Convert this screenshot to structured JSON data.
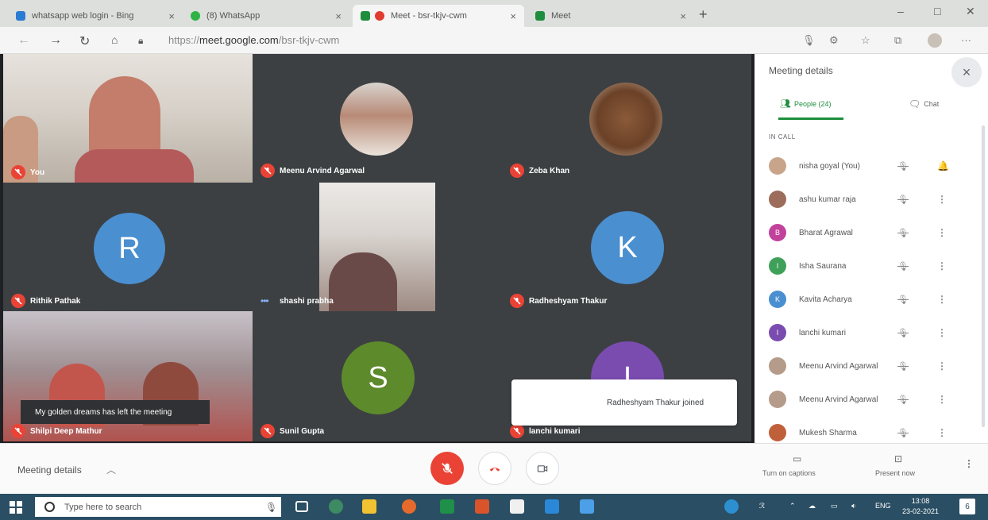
{
  "browser": {
    "tabs": [
      {
        "title": "whatsapp web login - Bing",
        "close": "×"
      },
      {
        "title": "(8) WhatsApp",
        "close": "×"
      },
      {
        "title": "Meet - bsr-tkjv-cwm",
        "close": "×"
      },
      {
        "title": "Meet",
        "close": "×"
      }
    ],
    "new_tab": "+",
    "url_prefix": "https://",
    "url_host": "meet.google.com",
    "url_path": "/bsr-tkjv-cwm"
  },
  "tiles": [
    {
      "name": "You"
    },
    {
      "name": "Meenu Arvind Agarwal"
    },
    {
      "name": "Zeba Khan"
    },
    {
      "name": "Rithik Pathak",
      "initial": "R",
      "color": "#4a8fd0"
    },
    {
      "name": "shashi prabha"
    },
    {
      "name": "Radheshyam Thakur",
      "initial": "K",
      "color": "#4a8fd0"
    },
    {
      "name": "Shilpi Deep Mathur"
    },
    {
      "name": "Sunil Gupta",
      "initial": "S",
      "color": "#5d8a2b"
    },
    {
      "name": "lanchi kumari",
      "initial": "I",
      "color": "#7b4cb0"
    }
  ],
  "toasts": {
    "left": "My golden dreams has left the meeting",
    "right": "Radheshyam Thakur joined"
  },
  "panel": {
    "title": "Meeting details",
    "close": "×",
    "tab_people": "People (24)",
    "tab_chat": "Chat",
    "section": "IN CALL",
    "people": [
      {
        "name": "nisha goyal (You)",
        "initial": "",
        "color": "#c8a58a",
        "more": "🔔"
      },
      {
        "name": "ashu kumar raja",
        "initial": "",
        "color": "#9b6d5a",
        "more": "⋮"
      },
      {
        "name": "Bharat Agrawal",
        "initial": "B",
        "color": "#c2429b",
        "more": "⋮"
      },
      {
        "name": "Isha Saurana",
        "initial": "I",
        "color": "#3fa05a",
        "more": "⋮"
      },
      {
        "name": "Kavita Acharya",
        "initial": "K",
        "color": "#4a8fd0",
        "more": "⋮"
      },
      {
        "name": "lanchi kumari",
        "initial": "I",
        "color": "#7b4cb0",
        "more": "⋮"
      },
      {
        "name": "Meenu Arvind Agarwal",
        "initial": "",
        "color": "#b59b8a",
        "more": "⋮"
      },
      {
        "name": "Meenu Arvind Agarwal",
        "initial": "",
        "color": "#b59b8a",
        "more": "⋮"
      },
      {
        "name": "Mukesh Sharma",
        "initial": "",
        "color": "#c0603a",
        "more": "⋮"
      }
    ]
  },
  "bottom": {
    "meeting_details": "Meeting details",
    "captions": "Turn on captions",
    "present": "Present now"
  },
  "taskbar": {
    "search_placeholder": "Type here to search",
    "lang": "ENG",
    "time": "13:08",
    "date": "23-02-2021",
    "notif": "6"
  }
}
